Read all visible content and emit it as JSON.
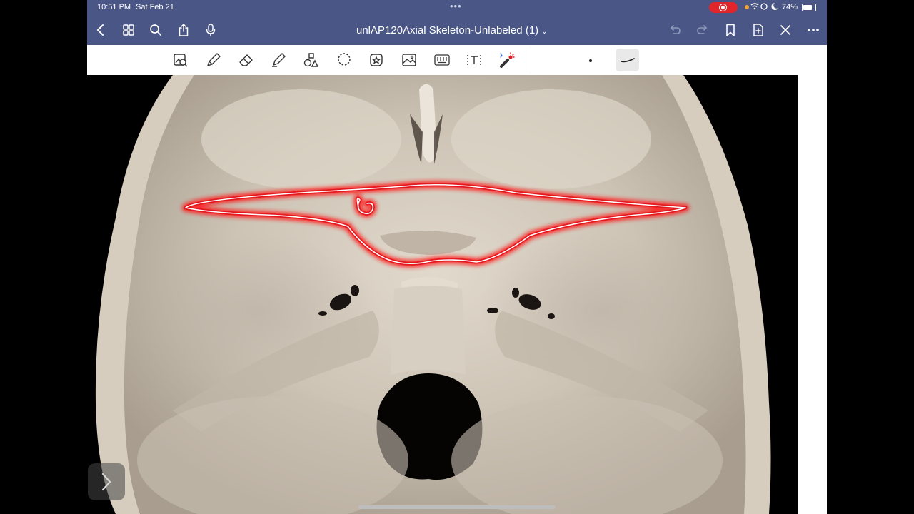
{
  "status": {
    "time": "10:51 PM",
    "date": "Sat Feb 21",
    "battery": "74%",
    "battery_level": 0.74
  },
  "document": {
    "title": "unlAP120Axial Skeleton-Unlabeled (1)"
  },
  "nav": {
    "left_icons": [
      "back-icon",
      "grid-icon",
      "search-icon",
      "share-icon",
      "microphone-icon"
    ],
    "right_icons": [
      "undo-icon",
      "redo-icon",
      "bookmark-icon",
      "add-page-icon",
      "close-icon",
      "more-icon"
    ]
  },
  "toolbar": {
    "tools": [
      "zoom-select-icon",
      "pen-icon",
      "eraser-icon",
      "highlighter-icon",
      "shapes-icon",
      "lasso-icon",
      "sticker-icon",
      "image-icon",
      "keyboard-icon",
      "text-icon",
      "laser-pointer-icon"
    ]
  },
  "colors": {
    "nav_bar": "#4a5786",
    "annotation": "#e3191f",
    "bone": "#cdc4b6"
  }
}
